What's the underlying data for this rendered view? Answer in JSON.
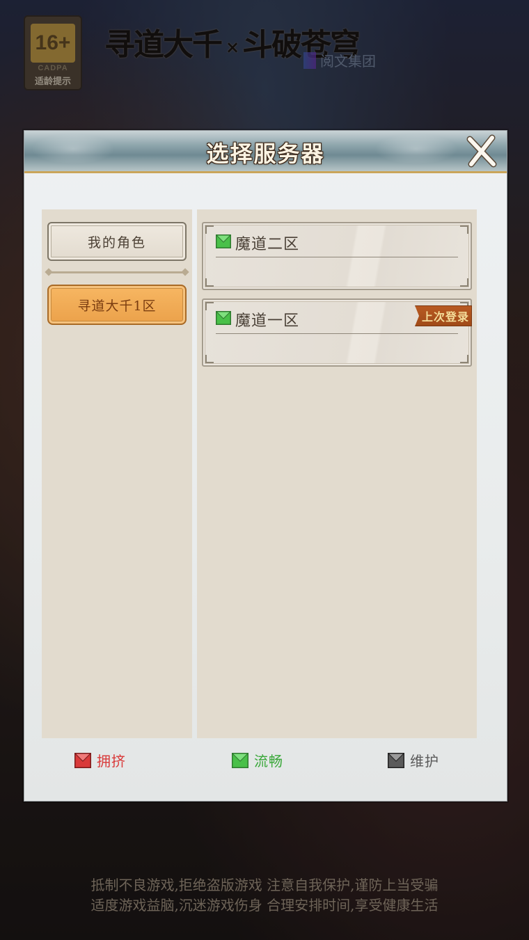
{
  "background": {
    "age_badge": {
      "rating": "16+",
      "org": "CADPA",
      "tip": "适龄提示"
    },
    "logo": {
      "left_text": "寻道大千",
      "x": "×",
      "right_text": "斗破苍穹"
    },
    "publisher": "阅文集团",
    "footer_notice": {
      "line1": "抵制不良游戏,拒绝盗版游戏 注意自我保护,谨防上当受骗",
      "line2": "适度游戏益脑,沉迷游戏伤身 合理安排时间,享受健康生活"
    }
  },
  "dialog": {
    "title": "选择服务器",
    "close_icon": "close-x-icon",
    "left_panel": {
      "my_roles_label": "我的角色",
      "zone_label": "寻道大千1区"
    },
    "servers": [
      {
        "name": "魔道二区",
        "status": "smooth",
        "last_login": null
      },
      {
        "name": "魔道一区",
        "status": "smooth",
        "last_login": "上次登录"
      }
    ],
    "legend": [
      {
        "label": "拥挤",
        "status": "crowded",
        "color": "#d93a3a"
      },
      {
        "label": "流畅",
        "status": "smooth",
        "color": "#3aa83a"
      },
      {
        "label": "维护",
        "status": "maintenance",
        "color": "#5a5a5a"
      }
    ]
  }
}
